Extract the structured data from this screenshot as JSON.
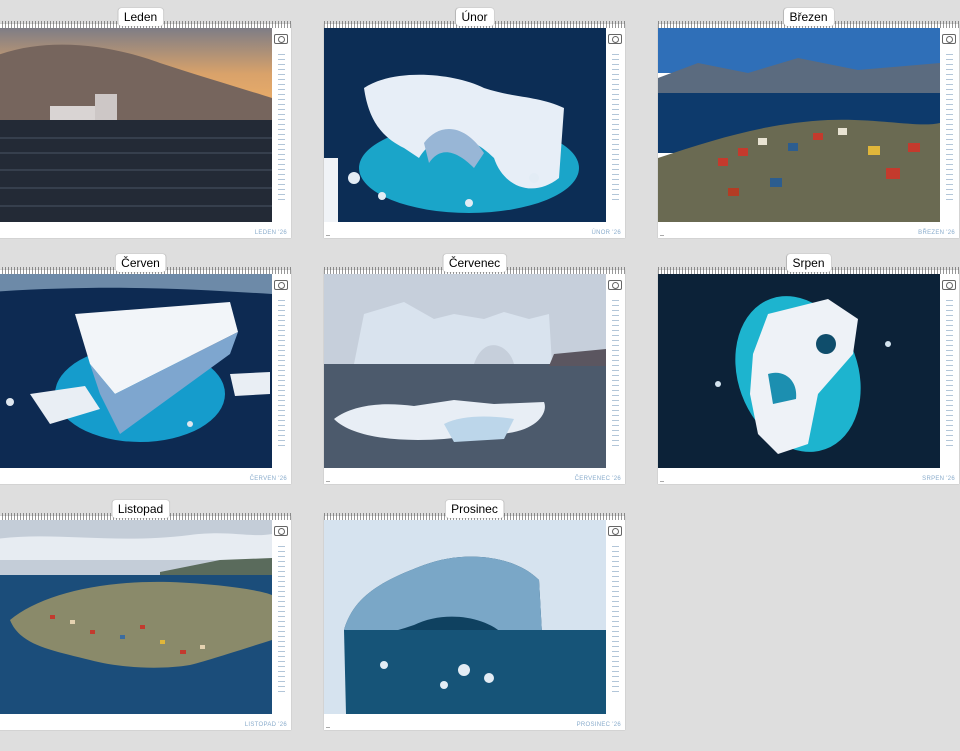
{
  "months": [
    {
      "label": "Leden",
      "footer": "LEDEN '26"
    },
    {
      "label": "Únor",
      "footer": "ÚNOR '26"
    },
    {
      "label": "Březen",
      "footer": "BŘEZEN '26"
    },
    {
      "label": "Červen",
      "footer": "ČERVEN '26"
    },
    {
      "label": "Červenec",
      "footer": "ČERVENEC '26"
    },
    {
      "label": "Srpen",
      "footer": "SRPEN '26"
    },
    {
      "label": "Listopad",
      "footer": "LISTOPAD '26"
    },
    {
      "label": "Prosinec",
      "footer": "PROSINEC '26"
    }
  ]
}
